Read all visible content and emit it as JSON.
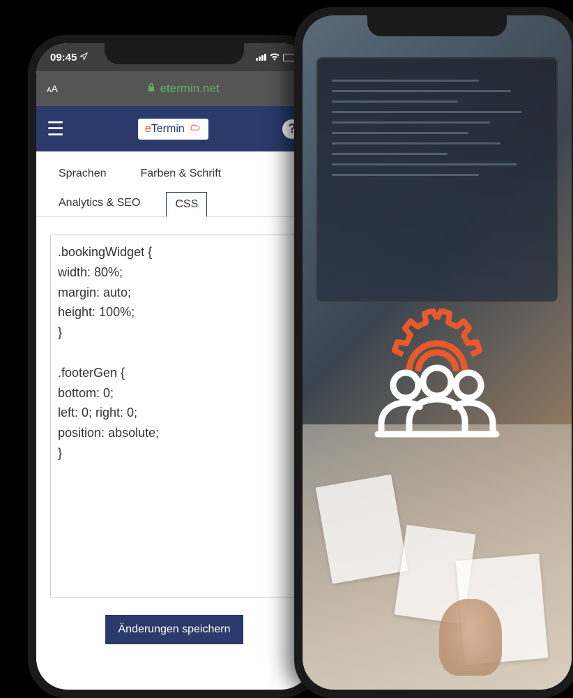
{
  "status_bar": {
    "time": "09:45",
    "location_icon": "✈"
  },
  "url_bar": {
    "text_size": "AA",
    "domain": "etermin.net"
  },
  "header": {
    "brand_e": "e",
    "brand_termin": "Termin",
    "help_label": "?"
  },
  "tabs": {
    "row1": [
      {
        "label": "Sprachen"
      },
      {
        "label": "Farben & Schrift"
      }
    ],
    "row2": [
      {
        "label": "Analytics & SEO"
      },
      {
        "label": "CSS",
        "active": true
      }
    ]
  },
  "editor": {
    "css_content": ".bookingWidget {\nwidth: 80%;\nmargin: auto;\nheight: 100%;\n}\n\n.footerGen {\nbottom: 0;\nleft: 0; right: 0;\nposition: absolute;\n}"
  },
  "buttons": {
    "save": "Änderungen speichern"
  }
}
